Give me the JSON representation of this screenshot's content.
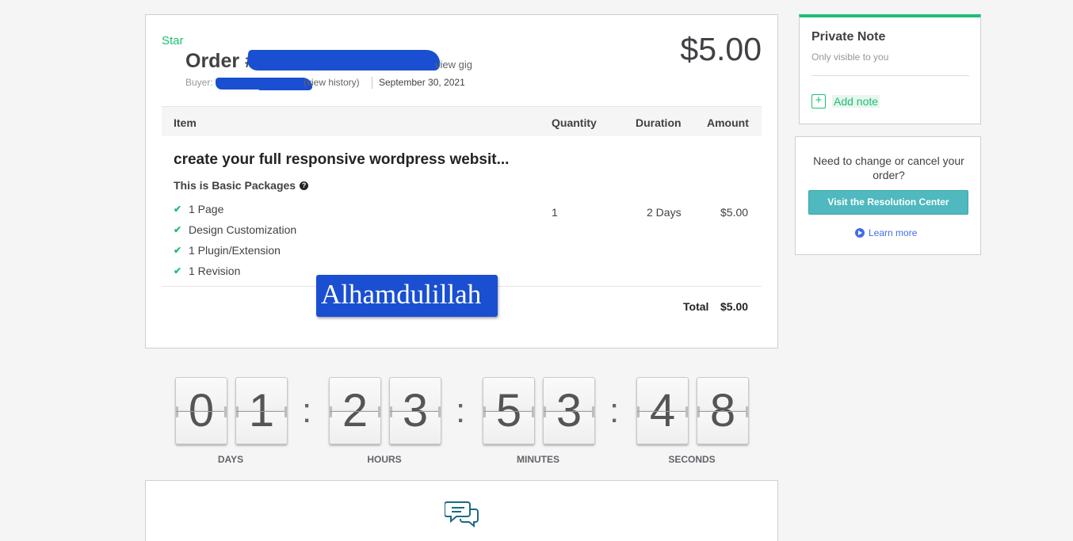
{
  "order": {
    "star_label": "Star",
    "title": "Order #",
    "view_gig_label": "view gig",
    "buyer_label": "Buyer:",
    "view_history_label": "(view history)",
    "date": "September 30, 2021",
    "price": "$5.00"
  },
  "table": {
    "headers": {
      "item": "Item",
      "quantity": "Quantity",
      "duration": "Duration",
      "amount": "Amount"
    },
    "row": {
      "title": "create your full responsive wordpress websit...",
      "package": "This is Basic Packages",
      "features": [
        "1 Page",
        "Design Customization",
        "1 Plugin/Extension",
        "1 Revision"
      ],
      "quantity": "1",
      "duration": "2 Days",
      "amount": "$5.00"
    },
    "total_label": "Total",
    "total_value": "$5.00"
  },
  "sticker_text": "Alhamdulillah",
  "countdown": {
    "days": [
      "0",
      "1"
    ],
    "hours": [
      "2",
      "3"
    ],
    "minutes": [
      "5",
      "3"
    ],
    "seconds": [
      "4",
      "8"
    ],
    "separator": ":",
    "labels": {
      "days": "DAYS",
      "hours": "HOURS",
      "minutes": "MINUTES",
      "seconds": "SECONDS"
    }
  },
  "private_note": {
    "title": "Private Note",
    "subtitle": "Only visible to you",
    "add_note_label": "Add note"
  },
  "resolution": {
    "text": "Need to change or cancel your order?",
    "button_label": "Visit the Resolution Center",
    "learn_more_label": "Learn more"
  },
  "colors": {
    "accent_green": "#1dbf73",
    "redaction_blue": "#1a4fd1",
    "resolution_teal": "#4fb9bf",
    "link_blue": "#446ee7"
  },
  "icons": [
    "check-icon",
    "info-icon",
    "add-note-icon",
    "play-icon",
    "chat-icon"
  ]
}
